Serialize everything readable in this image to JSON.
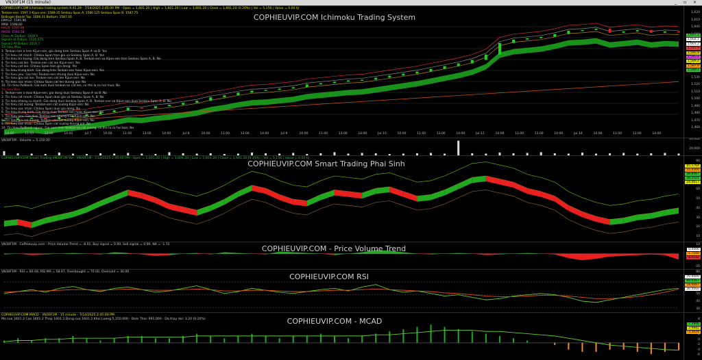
{
  "window": {
    "title": "VN30F1M (15 minute)",
    "controls": "_ ▫ ×"
  },
  "panels": [
    {
      "key": "ichimoku",
      "title": "COPHIEUVIP.COM Ichimoku Trading System",
      "header": "COPHIEUVIP.COM Ichimoku trading system 9.41.29 - 7/14/2025 2:45:00 PM - Open = 1,601.20 | High = 1,601.20 | Low = 1,601.20 | Close = 1,601.20 (0.20%) | Vol = 5,150 | Value = 0.00 tỷ",
      "legend": [
        {
          "text": "Tenkan-sen: 1597.3  Kijun-sen: 1589.35  Senkou Span A: 1580.125  Senkou Span B: 1587.75",
          "color": "#e8e800"
        },
        {
          "text": "Bollinger Bands Top: 1606.21  Bottom: 1587.16",
          "color": "#e8e800"
        },
        {
          "text": "EMA12: 1595.96",
          "color": "#ccc"
        },
        {
          "text": "MA9: 1598.60",
          "color": "#ccc"
        },
        {
          "text": "MA20: 1597.94",
          "color": "#e04040"
        },
        {
          "text": "MA50: 1593.58",
          "color": "#e040e0"
        },
        {
          "text": "Close At Daiboo: 1608.9",
          "color": "#30c030"
        },
        {
          "text": "Signals at Daboo: 1520.575",
          "color": "#30c030"
        },
        {
          "text": "Signal2 At Daboo: 1516.7",
          "color": "#30c030"
        },
        {
          "text": "Tin hieu Mua",
          "color": "#30c030"
        },
        {
          "text": "1. Tenkan-sen o tren Kijun-sen, gia dong tren Senkou Span A va B: Yes",
          "color": "#ccc"
        },
        {
          "text": "2. Tin hieu rat manh: Chikou Span tren gia va Senkou Span A, B: Yes",
          "color": "#ccc"
        },
        {
          "text": "3. Tin hieu tin tuong: Gia dong tren Senkou Span A, B. Tenkan-sen va Kijun-sen tren Senkou Span A, B: No",
          "color": "#ccc"
        },
        {
          "text": "4. Tin hieu cat len: Tenkan-sen cat len Kijun-sen: Yes",
          "color": "#ccc"
        },
        {
          "text": "5. Tin hieu cat len: Chikou Span tren gia dong: Yes",
          "color": "#ccc"
        },
        {
          "text": "6. Tin hieu trung binh: Gia dong tren Tenkan-sen hoac Kijun-sen: Yes",
          "color": "#ccc"
        },
        {
          "text": "7. Tin hieu yeu: Gia tren Tenkan-sen nhung duoi Kijun-sen: No",
          "color": "#ccc"
        },
        {
          "text": "8. Tin hieu gia cat len: Tenkan-sen cat len Kijun-sen: No",
          "color": "#ccc"
        },
        {
          "text": "9. Tin hieu xac nhan: Chikou Span cat len duong gia: No",
          "color": "#ccc"
        },
        {
          "text": "10. Tin hieu Pullback: Gia sam duoi tenkan-se cat len, co the la co hoi mua: No",
          "color": "#ccc"
        },
        {
          "text": "Tin hieu Ban",
          "color": "#e03030"
        },
        {
          "text": "1. Tenkan-sen o duoi Kijun-sen, gia dong duoi Senkou Span A va B: No",
          "color": "#ccc"
        },
        {
          "text": "2. Tin hieu rat manh: Chikou Span duoi gia va Senkou Span A, B: No",
          "color": "#ccc"
        },
        {
          "text": "3. Tin hieu khang cu manh: Gia dong duoi Senkou Span A, B. Tenkan-sen va Kijun-sen duoi Senkou Span A, B: No",
          "color": "#ccc"
        },
        {
          "text": "4. Tin hieu cat xuong: Tenkan-sen cat xuong Kijun-sen: No",
          "color": "#ccc"
        },
        {
          "text": "5. Tin hieu xac nhan: Chikou Span duoi gia dong: No",
          "color": "#ccc"
        },
        {
          "text": "6. Tin hieu trung binh: Gia dong duoi Tenkan-sen hoac Kijun-sen: No",
          "color": "#ccc"
        },
        {
          "text": "7. Tin hieu yeu: Gia duoi Tenkan-sen nhung tren Kijun-sen: No",
          "color": "#ccc"
        },
        {
          "text": "8. Tin hieu gia cat xuong: Tenkan-sen cat xuong Kijun-sen: No",
          "color": "#ccc"
        },
        {
          "text": "9. Tin hieu xac nhan: Chikou Span cat xuong duong gia: No",
          "color": "#ccc"
        },
        {
          "text": "10. Tin hieu Pullback nguoc: Gia nam tren tenkan-se cat xuong, co the la co hoi ban: No",
          "color": "#ccc"
        }
      ],
      "yticks": [
        "1,620",
        "1,610",
        "1,600",
        "1,590",
        "1,580",
        "1,570",
        "1,560",
        "1,550",
        "1,540",
        "1,530",
        "1,520",
        "1,510",
        "1,500",
        "1,490",
        "1,480",
        "1,470",
        "1,460"
      ],
      "price_tags": [
        {
          "text": "1,607.2",
          "color": "#30c030"
        },
        {
          "text": "1,602.1",
          "color": "#ffffff"
        },
        {
          "text": "1,601.2",
          "color": "#ffffff"
        },
        {
          "text": "1,597.9",
          "color": "#e04040"
        },
        {
          "text": "1,595.9",
          "color": "#e0c000"
        },
        {
          "text": "1,593.6",
          "color": "#e040e0"
        },
        {
          "text": "1,589.4",
          "color": "#e0e000"
        },
        {
          "text": "1,587.8",
          "color": "#ff9900"
        },
        {
          "text": "1,580.1",
          "color": "#30c030"
        }
      ],
      "xlabels": [
        "10:00",
        "11:00",
        "13:00",
        "14:00",
        "Jul 7",
        "10:00",
        "11:00",
        "13:00",
        "14:00",
        "Jul 8",
        "10:00",
        "11:00",
        "13:00",
        "14:00",
        "Jul 9",
        "10:00",
        "11:00",
        "13:00",
        "14:00",
        "Jul 10",
        "10:00",
        "11:00",
        "13:00",
        "14:00",
        "Jul 11",
        "10:00",
        "11:00",
        "13:00",
        "14:00",
        "Jul 14",
        "10:00",
        "11:00",
        "13:00",
        "14:00"
      ]
    },
    {
      "key": "volume",
      "title": "",
      "header": "VN30F1M - Volume = 5,150.00",
      "yticks": [
        "40,000",
        "20,000"
      ],
      "price_tags": []
    },
    {
      "key": "smart",
      "title": "COPHIEUVIP.COM Smart Trading Phai Sinh",
      "header": "COPHIEUVIP.COM Smart Trading VN30F1M Vol - VN30F1M - 7/14/2025 2:45:00 PM - Open = 1,601.20 | High = 1,601.20 | Low = 1,601.20 | Close = 1,601.20 (0.20%) | Vol = 5,150 | Value = 0.00 tỷ",
      "yticks": [
        "90",
        "80",
        "70",
        "60",
        "50",
        "40",
        "30",
        "20",
        "10"
      ],
      "price_tags": [
        {
          "text": "85.1764",
          "color": "#e0e000"
        },
        {
          "text": "55.4366",
          "color": "#ff9900"
        },
        {
          "text": "38.8467",
          "color": "#30c030"
        },
        {
          "text": "36.3101",
          "color": "#30c030"
        },
        {
          "text": "24.0617",
          "color": "#e0e000"
        }
      ]
    },
    {
      "key": "pvt",
      "title": "COPHIEUVIP.COM - Price Volume Trend",
      "header": "VN30F1M - CoPhieuvip.com - Price Volume Trend = -8.01, Buy signal = 0.00, Sell signal = 0.00, NA = -1.72",
      "yticks": [
        "10",
        "0",
        "-10",
        "-20"
      ],
      "price_tags": [
        {
          "text": "0.0000",
          "color": "#ffffff"
        },
        {
          "text": "-1.7160",
          "color": "#ff9900"
        },
        {
          "text": "-8.0142",
          "color": "#e03030"
        }
      ]
    },
    {
      "key": "rsi",
      "title": "COPHIEUVIP.COM RSI",
      "header": "VN30F1M - RSI = 60.04, RSI MA = 58.67, Overbought = 70.00, Oversold = 30.00",
      "yticks": [
        "80",
        "70",
        "60",
        "50",
        "40",
        "30"
      ],
      "price_tags": [
        {
          "text": "70.0000",
          "color": "#ffffff"
        },
        {
          "text": "60.0367",
          "color": "#30c030"
        },
        {
          "text": "58.6667",
          "color": "#ff9900"
        },
        {
          "text": "30.0000",
          "color": "#ffffff"
        }
      ]
    },
    {
      "key": "macd",
      "title": "COPHIEUVIP.COM - MCAD",
      "header": "COPHIEUVIP.COM MACD - VN30F1M - 15 minute - 7/14/2025 2:45:00 PM",
      "header2": "Mo cua 1601.2  Cao 1601.2  Thap 1601.2  Dong cua 1601.2  Khoi Luong 5,150.000 - Dem Thoi: 991,000 - Da thay doi: 3.20 (0.20%)",
      "yticks": [
        "8",
        "6",
        "4",
        "2",
        "0",
        "-2",
        "-4",
        "-6"
      ],
      "price_tags": [
        {
          "text": "7.2906",
          "color": "#30c030"
        },
        {
          "text": "3.9882",
          "color": "#e0e000"
        },
        {
          "text": "-3.3024",
          "color": "#ff9900"
        }
      ]
    }
  ],
  "chart_data": [
    {
      "type": "line",
      "title": "COPHIEUVIP.COM Ichimoku Trading System",
      "note_series": "Close price (approx.)",
      "ylim": [
        1460,
        1625
      ],
      "series": [
        {
          "values": [
            1472,
            1474,
            1475,
            1473,
            1476,
            1478,
            1480,
            1483,
            1486,
            1490,
            1489,
            1492,
            1494,
            1497,
            1500,
            1505,
            1508,
            1512,
            1515,
            1516,
            1518,
            1520,
            1524,
            1526,
            1528,
            1530,
            1531,
            1534,
            1537,
            1540,
            1543,
            1547,
            1551,
            1555,
            1560,
            1568,
            1585,
            1590,
            1592,
            1594,
            1598,
            1603,
            1604,
            1606,
            1600,
            1602,
            1604,
            1600,
            1602,
            1601.2
          ]
        }
      ]
    },
    {
      "type": "bar",
      "ylim": [
        0,
        45000
      ],
      "series": [
        {
          "values": [
            12000,
            6000,
            5000,
            4000,
            8000,
            5000,
            4000,
            6000,
            5000,
            7000,
            5000,
            4000,
            9000,
            6000,
            5000,
            6000,
            4000,
            5000,
            8000,
            6000,
            5000,
            7000,
            4000,
            6000,
            9000,
            5000,
            7000,
            6000,
            4000,
            5000,
            6000,
            7000,
            5000,
            42000,
            6000,
            5000,
            8000,
            6000,
            7000,
            9000,
            6000,
            5000,
            8000,
            5000,
            6000,
            7000,
            5000,
            6000,
            7000,
            5150
          ]
        }
      ]
    },
    {
      "type": "area",
      "ylim": [
        0,
        95
      ],
      "series": [
        {
          "values": [
            22,
            24,
            20,
            26,
            30,
            34,
            40,
            48,
            55,
            62,
            58,
            52,
            44,
            40,
            36,
            42,
            50,
            60,
            68,
            64,
            56,
            50,
            48,
            56,
            62,
            60,
            58,
            64,
            66,
            60,
            54,
            56,
            62,
            70,
            78,
            80,
            76,
            72,
            64,
            60,
            54,
            42,
            34,
            28,
            24,
            26,
            30,
            32,
            36,
            38.8
          ]
        }
      ]
    },
    {
      "type": "area",
      "ylim": [
        -20,
        10
      ],
      "series": [
        {
          "values": [
            -1,
            0,
            -2,
            -1,
            0,
            1,
            0,
            -1,
            2,
            1,
            -1,
            -3,
            -2,
            0,
            1,
            -1,
            2,
            1,
            0,
            -1,
            3,
            2,
            1,
            0,
            -2,
            0,
            2,
            5,
            4,
            2,
            0,
            -1,
            0,
            1,
            0,
            -2,
            -1,
            0,
            1,
            0,
            -1,
            -6,
            -9,
            -7,
            -4,
            -3,
            -2,
            -1,
            -2,
            -8.0
          ]
        }
      ]
    },
    {
      "type": "line",
      "ylim": [
        25,
        85
      ],
      "series": [
        {
          "values": [
            52,
            55,
            58,
            54,
            60,
            63,
            58,
            55,
            60,
            62,
            58,
            54,
            56,
            60,
            64,
            58,
            52,
            55,
            60,
            57,
            54,
            52,
            55,
            58,
            60,
            56,
            62,
            66,
            58,
            54,
            56,
            52,
            48,
            50,
            46,
            42,
            44,
            48,
            50,
            52,
            50,
            46,
            40,
            38,
            42,
            46,
            50,
            54,
            58,
            60.04
          ]
        },
        {
          "values": [
            54,
            55,
            56,
            56,
            57,
            58,
            58,
            57,
            58,
            59,
            58,
            57,
            57,
            58,
            59,
            58,
            56,
            56,
            57,
            57,
            56,
            55,
            55,
            56,
            57,
            57,
            58,
            59,
            58,
            57,
            56,
            55,
            53,
            52,
            50,
            48,
            47,
            47,
            48,
            49,
            49,
            48,
            46,
            44,
            44,
            45,
            47,
            50,
            54,
            58.67
          ]
        }
      ]
    },
    {
      "type": "bar",
      "ylim": [
        -7,
        9
      ],
      "series": [
        {
          "values": [
            1,
            2,
            1,
            2,
            2,
            3,
            2,
            1,
            2,
            3,
            3,
            2,
            2,
            3,
            4,
            3,
            2,
            3,
            4,
            3,
            2,
            3,
            3,
            4,
            3,
            2,
            3,
            4,
            5,
            6,
            7,
            8,
            7,
            6,
            5,
            4,
            3,
            2,
            1,
            0,
            -1,
            -3,
            -4,
            -4,
            -3,
            -3,
            -4,
            -5,
            -4,
            -3.3
          ]
        },
        {
          "values": [
            0.5,
            1,
            1,
            1.5,
            1.5,
            2,
            2,
            2,
            2,
            2.5,
            2.5,
            2.5,
            2.5,
            2.5,
            3,
            3,
            3,
            3,
            3,
            3,
            3,
            3,
            3,
            3,
            3,
            3,
            3,
            3.5,
            3.5,
            4,
            4.5,
            5,
            5.5,
            5.5,
            5.5,
            5,
            5,
            4.5,
            4,
            3.5,
            3,
            2,
            1,
            0,
            -1,
            -1.5,
            -2,
            -2.5,
            -3,
            -3.3
          ]
        }
      ]
    }
  ]
}
